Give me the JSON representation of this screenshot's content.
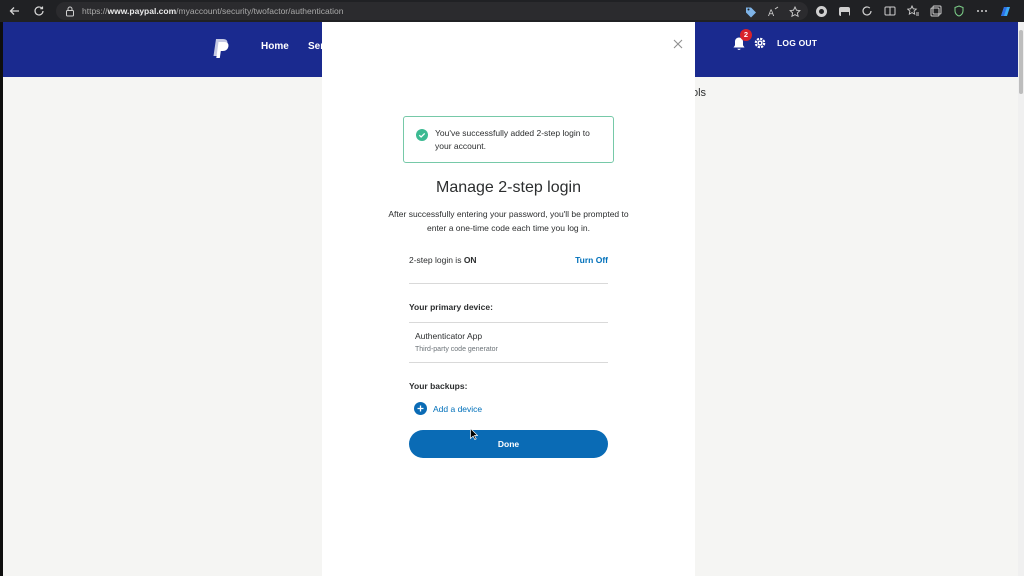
{
  "browser": {
    "url_prefix": "https://",
    "url_host": "www.paypal.com",
    "url_path": "/myaccount/security/twofactor/authentication"
  },
  "header": {
    "home_label": "Home",
    "partial_nav_label": "Ser",
    "notification_count": "2",
    "logout_label": "LOG OUT",
    "partial_right_text": "ols"
  },
  "modal": {
    "success_message": "You've successfully added 2-step login to your account.",
    "title": "Manage 2-step login",
    "description": "After successfully entering your password, you'll be prompted to enter a one-time code each time you log in.",
    "status_prefix": "2-step login is ",
    "status_value": "ON",
    "turn_off_label": "Turn Off",
    "primary_device_label": "Your primary device:",
    "device_name": "Authenticator App",
    "device_description": "Third-party code generator",
    "backups_label": "Your backups:",
    "add_device_label": "Add a device",
    "done_label": "Done"
  },
  "colors": {
    "header_bg": "#1a2a8f",
    "accent_blue": "#0070ba",
    "success_green": "#3cba92",
    "badge_red": "#d8232a"
  }
}
